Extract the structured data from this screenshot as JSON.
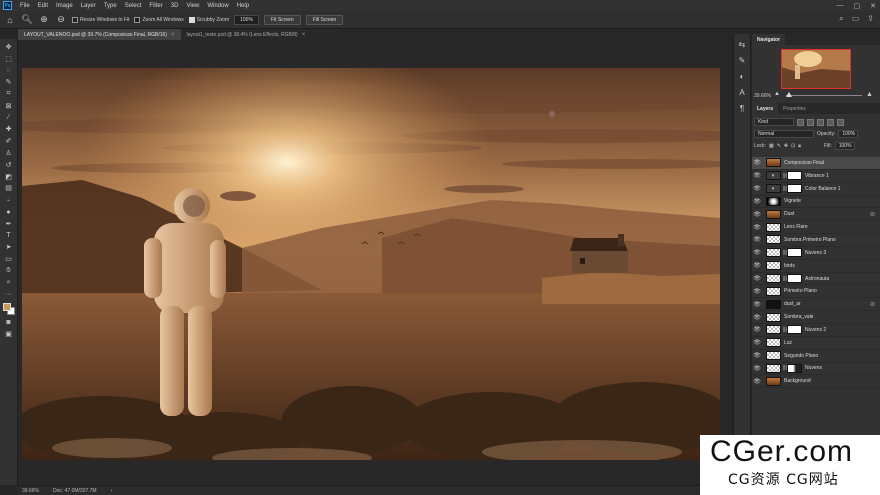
{
  "app": {
    "logo_text": "Ps"
  },
  "menu": [
    "File",
    "Edit",
    "Image",
    "Layer",
    "Type",
    "Select",
    "Filter",
    "3D",
    "View",
    "Window",
    "Help"
  ],
  "window_controls": {
    "minimize": "—",
    "maximize": "▢",
    "close": "✕"
  },
  "options": {
    "resize_windows": "Resize Windows to Fit",
    "zoom_all": "Zoom All Windows",
    "scrubby_zoom": "Scrubby Zoom",
    "zoom_value": "100%",
    "fit_screen": "Fit Screen",
    "fill_screen": "Fill Screen"
  },
  "tabs": [
    {
      "label": "LAYOUT_VALENOO.psd @ 39.7% (Composicao Final, RGB/16)"
    },
    {
      "label": "layout1_teste.psd @ 38.4% (Lens Effects, RGB/8)"
    }
  ],
  "statusbar": {
    "zoom": "39.66%",
    "doc": "Doc: 47.0M/307.7M",
    "arrow": "›"
  },
  "panels": {
    "navigator_tab": "Navigator",
    "navigator_zoom": "39.66%",
    "layers_tab": "Layers",
    "properties_tab": "Properties",
    "kind_label": "Kind",
    "blend_mode": "Normal",
    "opacity_label": "Opacity:",
    "opacity_value": "100%",
    "lock_label": "Lock:",
    "fill_label": "Fill:",
    "fill_value": "100%"
  },
  "layers": [
    {
      "name": "Composicao Final",
      "thumb": "photo",
      "selected": true
    },
    {
      "name": "Vibrance 1",
      "thumb": "adj",
      "mask": "w"
    },
    {
      "name": "Color Balance 1",
      "thumb": "adj",
      "mask": "w"
    },
    {
      "name": "Vignete",
      "thumb": "vignette"
    },
    {
      "name": "Dust",
      "thumb": "photo",
      "fx": true
    },
    {
      "name": "Lens Flare",
      "thumb": "checker"
    },
    {
      "name": "Sombra Primeiro Plano",
      "thumb": "checker"
    },
    {
      "name": "Nuvens 3",
      "thumb": "checker",
      "mask": "w"
    },
    {
      "name": "birds",
      "thumb": "checker"
    },
    {
      "name": "Astronauta",
      "thumb": "checker",
      "mask": "w"
    },
    {
      "name": "Primeiro Plano",
      "thumb": "checker"
    },
    {
      "name": "dust_ar",
      "thumb": "dark",
      "fx": true
    },
    {
      "name": "Sombra_vale",
      "thumb": "checker"
    },
    {
      "name": "Nuvens 2",
      "thumb": "checker",
      "mask": "w"
    },
    {
      "name": "Luz",
      "thumb": "checker"
    },
    {
      "name": "Segundo Plano",
      "thumb": "checker"
    },
    {
      "name": "Nuvens",
      "thumb": "checker",
      "mask": "b"
    },
    {
      "name": "Background",
      "thumb": "photo"
    }
  ],
  "watermark": {
    "main": "CGer.com",
    "sub": "CG资源 CG网站"
  }
}
